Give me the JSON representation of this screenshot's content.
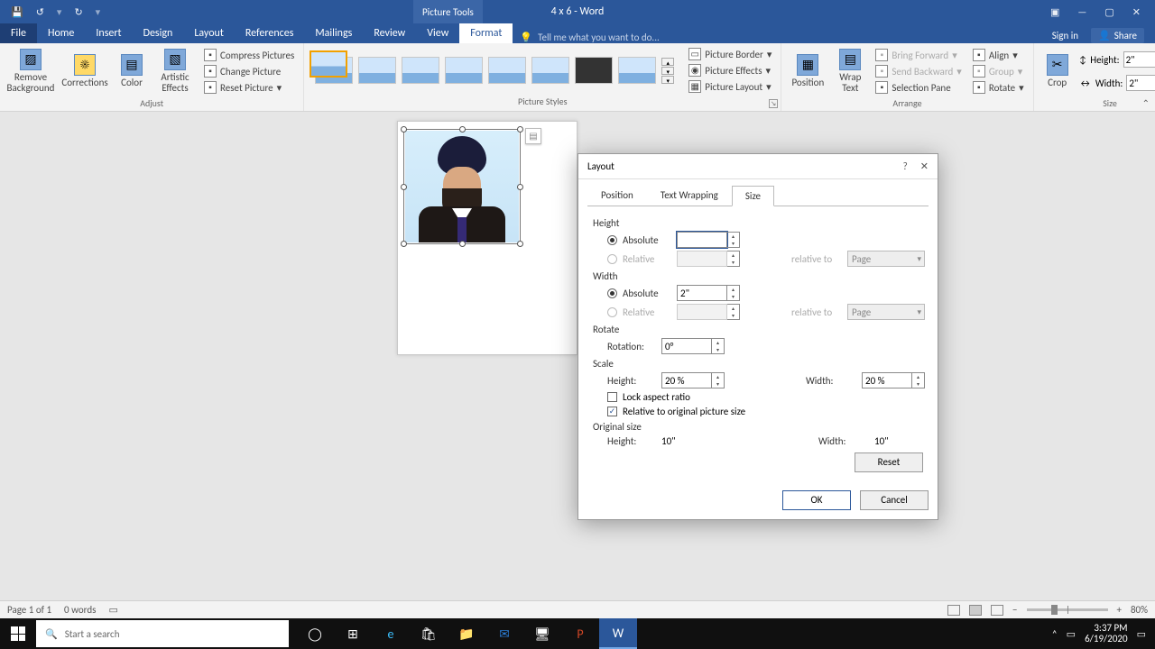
{
  "titlebar": {
    "doc_title": "4 x 6 - Word",
    "tool_tab": "Picture Tools"
  },
  "qat": {
    "save": "💾",
    "undo": "↺",
    "redo": "↻",
    "more": "▾"
  },
  "winbtns": {
    "opts": "▣",
    "min": "—",
    "max": "▢",
    "close": "✕"
  },
  "tabs": {
    "file": "File",
    "home": "Home",
    "insert": "Insert",
    "design": "Design",
    "layout": "Layout",
    "references": "References",
    "mailings": "Mailings",
    "review": "Review",
    "view": "View",
    "format": "Format"
  },
  "tellme": {
    "placeholder": "Tell me what you want to do..."
  },
  "signin": "Sign in",
  "share": "Share",
  "ribbon": {
    "adjust": {
      "label": "Adjust",
      "remove_bg": "Remove Background",
      "corrections": "Corrections",
      "color": "Color",
      "artistic": "Artistic Effects",
      "compress": "Compress Pictures",
      "change": "Change Picture",
      "reset": "Reset Picture"
    },
    "styles": {
      "label": "Picture Styles",
      "border": "Picture Border",
      "effects": "Picture Effects",
      "layout": "Picture Layout"
    },
    "arrange": {
      "label": "Arrange",
      "position": "Position",
      "wrap": "Wrap Text",
      "forward": "Bring Forward",
      "backward": "Send Backward",
      "selpane": "Selection Pane",
      "align": "Align",
      "group": "Group",
      "rotate": "Rotate"
    },
    "size": {
      "label": "Size",
      "crop": "Crop",
      "height_l": "Height:",
      "width_l": "Width:",
      "height_v": "2\"",
      "width_v": "2\""
    }
  },
  "dialog": {
    "title": "Layout",
    "tabs": {
      "position": "Position",
      "wrapping": "Text Wrapping",
      "size": "Size"
    },
    "height": {
      "label": "Height",
      "absolute": "Absolute",
      "relative": "Relative",
      "abs_val": "",
      "rel_to_l": "relative to",
      "rel_to_v": "Page"
    },
    "width": {
      "label": "Width",
      "absolute": "Absolute",
      "relative": "Relative",
      "abs_val": "2\"",
      "rel_to_l": "relative to",
      "rel_to_v": "Page"
    },
    "rotate": {
      "label": "Rotate",
      "rotation_l": "Rotation:",
      "rotation_v": "0°"
    },
    "scale": {
      "label": "Scale",
      "height_l": "Height:",
      "height_v": "20 %",
      "width_l": "Width:",
      "width_v": "20 %",
      "lock": "Lock aspect ratio",
      "relative": "Relative to original picture size"
    },
    "orig": {
      "label": "Original size",
      "height_l": "Height:",
      "height_v": "10\"",
      "width_l": "Width:",
      "width_v": "10\""
    },
    "reset": "Reset",
    "ok": "OK",
    "cancel": "Cancel",
    "help": "?",
    "close": "✕"
  },
  "status": {
    "page": "Page 1 of 1",
    "words": "0 words",
    "zoom": "80%"
  },
  "taskbar": {
    "search_ph": "Start a search",
    "time": "3:37 PM",
    "date": "6/19/2020"
  }
}
